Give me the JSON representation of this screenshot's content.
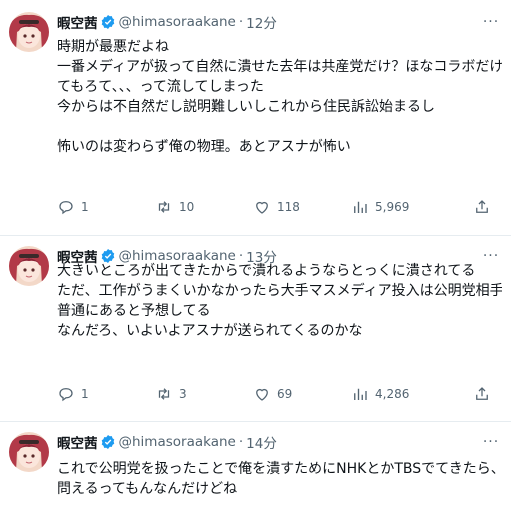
{
  "tweets": [
    {
      "author": {
        "name": "暇空茜",
        "handle": "@himasoraakane"
      },
      "dot": "·",
      "time": "12分",
      "more": "···",
      "lines": [
        "時期が最悪だよね",
        "一番メディアが扱って自然に潰せた去年は共産党だけ？ほなコラボだけ外し",
        "てもろて、、、って流してしまった",
        "今からは不自然だし説明難しいしこれから住民訴訟始まるし",
        "",
        "怖いのは変わらず俺の物理。あとアスナが怖い"
      ],
      "stats": {
        "replies": "1",
        "retweets": "10",
        "likes": "118",
        "views": "5,969"
      }
    },
    {
      "author": {
        "name": "暇空茜",
        "handle": "@himasoraakane"
      },
      "dot": "·",
      "time": "13分",
      "more": "···",
      "lines": [
        "大きいところが出てきたからで潰れるようならとっくに潰されてる",
        "ただ、工作がうまくいかなかったら大手マスメディア投入は公明党相手なら",
        "普通にあると予想してる",
        "なんだろ、いよいよアスナが送られてくるのかな"
      ],
      "stats": {
        "replies": "1",
        "retweets": "3",
        "likes": "69",
        "views": "4,286"
      }
    },
    {
      "author": {
        "name": "暇空茜",
        "handle": "@himasoraakane"
      },
      "dot": "·",
      "time": "14分",
      "more": "···",
      "lines": [
        "これで公明党を扱ったことで俺を潰すためにNHKとかTBSでてきたら、鼎を",
        "問えるってもんなんだけどね"
      ]
    }
  ],
  "colors": {
    "verified": "#1d9bf0",
    "muted": "#536471",
    "text": "#0f1419",
    "divider": "#e6ecf0"
  },
  "icons": [
    "verified-badge-icon",
    "more-icon",
    "reply-icon",
    "retweet-icon",
    "like-icon",
    "views-icon",
    "share-icon"
  ]
}
